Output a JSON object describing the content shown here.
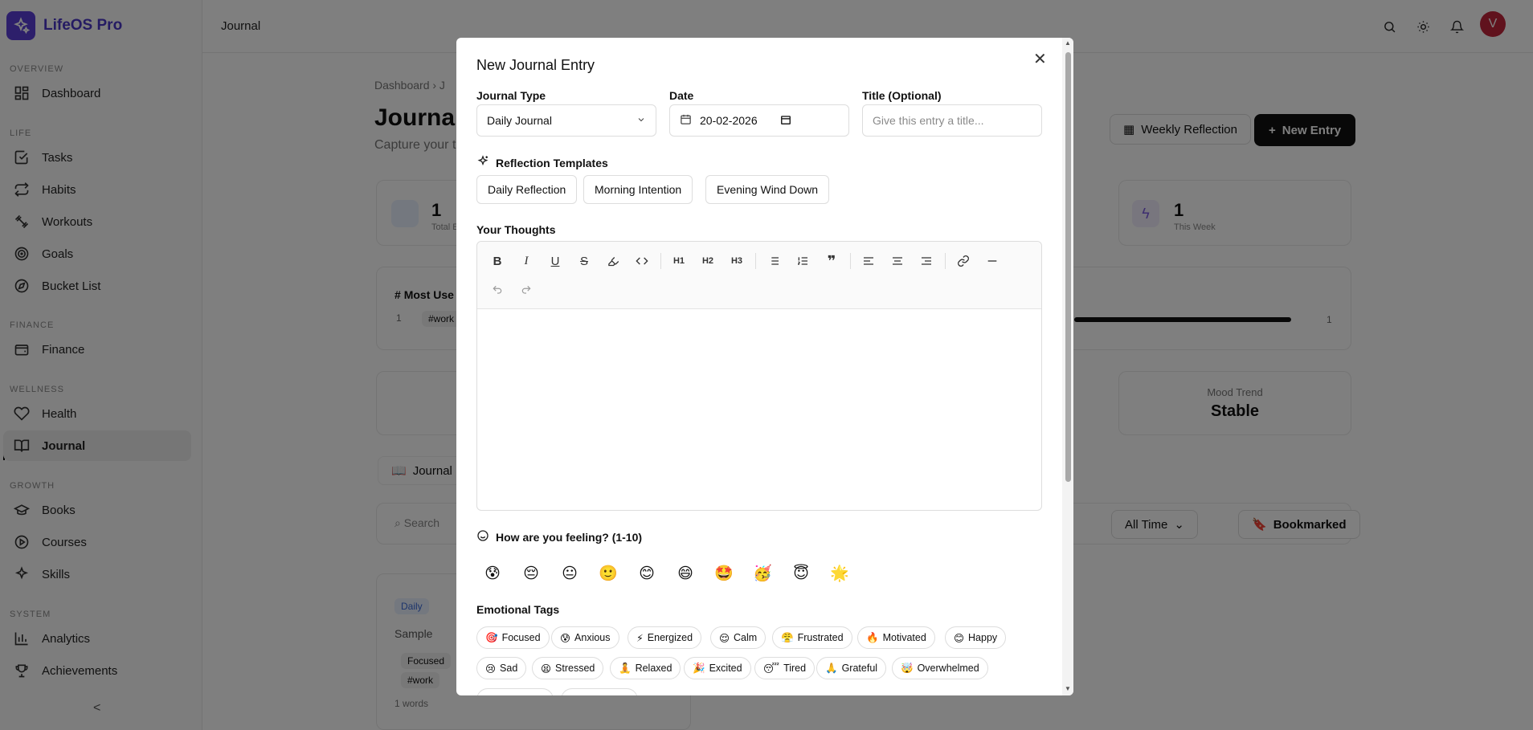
{
  "app": {
    "name": "LifeOS Pro"
  },
  "sidebar": {
    "sections": [
      "OVERVIEW",
      "LIFE",
      "FINANCE",
      "WELLNESS",
      "GROWTH",
      "SYSTEM"
    ],
    "items": [
      {
        "label": "Dashboard",
        "icon": "grid-icon"
      },
      {
        "label": "Tasks",
        "icon": "check-square-icon"
      },
      {
        "label": "Habits",
        "icon": "repeat-icon"
      },
      {
        "label": "Workouts",
        "icon": "dumbbell-icon"
      },
      {
        "label": "Goals",
        "icon": "target-icon"
      },
      {
        "label": "Bucket List",
        "icon": "compass-icon"
      },
      {
        "label": "Finance",
        "icon": "wallet-icon"
      },
      {
        "label": "Health",
        "icon": "heart-icon"
      },
      {
        "label": "Journal",
        "icon": "book-icon"
      },
      {
        "label": "Books",
        "icon": "graduation-cap-icon"
      },
      {
        "label": "Courses",
        "icon": "play-icon"
      },
      {
        "label": "Skills",
        "icon": "sparkles-icon"
      },
      {
        "label": "Analytics",
        "icon": "bar-chart-icon"
      },
      {
        "label": "Achievements",
        "icon": "trophy-icon"
      }
    ],
    "active": "Journal",
    "collapse_icon": "<"
  },
  "topbar": {
    "title": "Journal",
    "avatar_initial": "V"
  },
  "background": {
    "breadcrumb": "Dashboard  ›  J",
    "title": "Journal",
    "subtitle": "Capture your t",
    "weekly_reflection": "Weekly Reflection",
    "new_entry": "New Entry",
    "stats": [
      {
        "value": "1",
        "label": "Total E"
      },
      {
        "value": "1",
        "label": "This Week"
      }
    ],
    "most_used_label": "Most Use",
    "most_used_count": "1",
    "most_used_tag": "#work",
    "bar_value": "1",
    "mood_trend_label": "Mood Trend",
    "mood_trend_value": "Stable",
    "journal_tab": "Journal",
    "search_placeholder": "Search",
    "time_filter": "All Time",
    "bookmarked": "Bookmarked",
    "entry_badge": "Daily",
    "entry_title": "Sample",
    "entry_tag_focused": "Focused",
    "entry_tag_work": "#work",
    "entry_words": "1 words"
  },
  "modal": {
    "title": "New Journal Entry",
    "journal_type_label": "Journal Type",
    "journal_type_value": "Daily Journal",
    "date_label": "Date",
    "date_value": "20-02-2026",
    "title_label": "Title (Optional)",
    "title_placeholder": "Give this entry a title...",
    "templates_label": "Reflection Templates",
    "templates": [
      "Daily Reflection",
      "Morning Intention",
      "Evening Wind Down"
    ],
    "thoughts_label": "Your Thoughts",
    "toolbar": {
      "row1": [
        "B",
        "I",
        "U",
        "S",
        "highlight",
        "code",
        "H1",
        "H2",
        "H3",
        "bullet-list",
        "ordered-list",
        "quote",
        "align-left",
        "align-center",
        "align-right",
        "link",
        "horizontal-rule"
      ],
      "row2": [
        "undo",
        "redo"
      ]
    },
    "feeling_label": "How are you feeling? (1-10)",
    "moods": [
      "😰",
      "😔",
      "😐",
      "🙂",
      "😊",
      "😄",
      "🤩",
      "🥳",
      "😇",
      "🌟"
    ],
    "emotional_tags_label": "Emotional Tags",
    "emotional_tags": [
      {
        "emoji": "🎯",
        "label": "Focused"
      },
      {
        "emoji": "😰",
        "label": "Anxious"
      },
      {
        "emoji": "⚡",
        "label": "Energized"
      },
      {
        "emoji": "😌",
        "label": "Calm"
      },
      {
        "emoji": "😤",
        "label": "Frustrated"
      },
      {
        "emoji": "🔥",
        "label": "Motivated"
      },
      {
        "emoji": "😊",
        "label": "Happy"
      },
      {
        "emoji": "😢",
        "label": "Sad"
      },
      {
        "emoji": "😫",
        "label": "Stressed"
      },
      {
        "emoji": "🧘",
        "label": "Relaxed"
      },
      {
        "emoji": "🎉",
        "label": "Excited"
      },
      {
        "emoji": "😴",
        "label": "Tired"
      },
      {
        "emoji": "🙏",
        "label": "Grateful"
      },
      {
        "emoji": "🤯",
        "label": "Overwhelmed"
      }
    ],
    "close_icon": "close-icon"
  },
  "colors": {
    "brand": "#5b3fd6",
    "avatar": "#c0253a",
    "overlay": "rgba(0,0,0,0.5)"
  }
}
